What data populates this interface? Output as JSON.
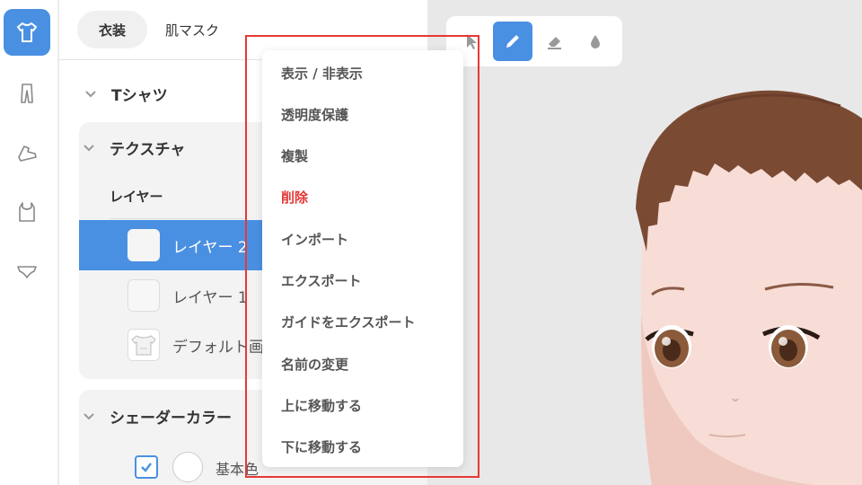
{
  "rail": {
    "items": [
      {
        "name": "tshirt",
        "icon": "tshirt-icon",
        "active": true
      },
      {
        "name": "pants",
        "icon": "pants-icon",
        "active": false
      },
      {
        "name": "shoes",
        "icon": "shoe-icon",
        "active": false
      },
      {
        "name": "tank-top",
        "icon": "tank-top-icon",
        "active": false
      },
      {
        "name": "underwear",
        "icon": "underwear-icon",
        "active": false
      }
    ]
  },
  "tabs": [
    {
      "label": "衣装",
      "active": true
    },
    {
      "label": "肌マスク",
      "active": false
    }
  ],
  "tree": {
    "tshirt_label": "Tシャツ",
    "texture_label": "テクスチャ",
    "layers_header": "レイヤー",
    "layers": [
      {
        "name": "レイヤー 2",
        "selected": true
      },
      {
        "name": "レイヤー 1",
        "selected": false
      },
      {
        "name": "デフォルト画",
        "selected": false
      }
    ],
    "shader_label": "シェーダーカラー",
    "base_color_label": "基本色",
    "base_color_checked": true
  },
  "toolbar": {
    "tools": [
      {
        "name": "select",
        "icon": "cursor-icon",
        "active": false
      },
      {
        "name": "pen",
        "icon": "pencil-icon",
        "active": true
      },
      {
        "name": "eraser",
        "icon": "eraser-icon",
        "active": false
      },
      {
        "name": "fill",
        "icon": "drop-icon",
        "active": false
      }
    ]
  },
  "context_menu": {
    "items": [
      {
        "label": "表示 / 非表示",
        "danger": false
      },
      {
        "label": "透明度保護",
        "danger": false
      },
      {
        "label": "複製",
        "danger": false
      },
      {
        "label": "削除",
        "danger": true
      },
      {
        "label": "インポート",
        "danger": false
      },
      {
        "label": "エクスポート",
        "danger": false
      },
      {
        "label": "ガイドをエクスポート",
        "danger": false
      },
      {
        "label": "名前の変更",
        "danger": false
      },
      {
        "label": "上に移動する",
        "danger": false
      },
      {
        "label": "下に移動する",
        "danger": false
      }
    ]
  },
  "colors": {
    "accent": "#4a90e2",
    "danger": "#e53935",
    "panel_bg": "#f3f3f3",
    "viewport_bg": "#e8e8e8"
  }
}
